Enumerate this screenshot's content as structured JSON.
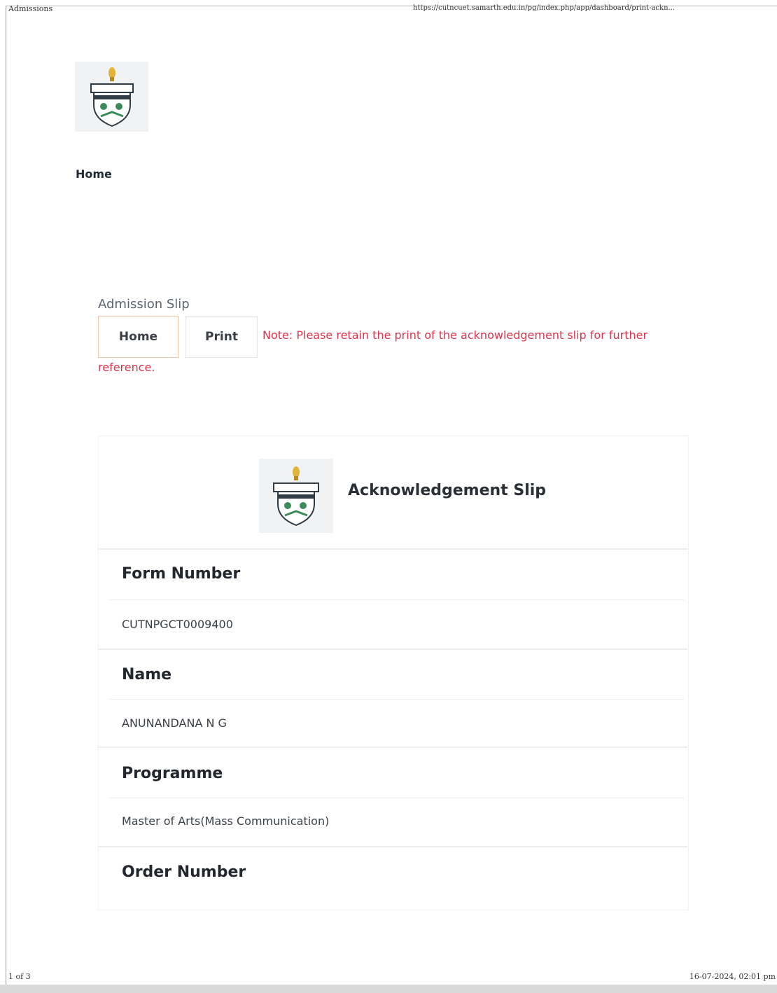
{
  "print_header": {
    "title": "Admissions",
    "url": "https://cutncuet.samarth.edu.in/pg/index.php/app/dashboard/print-ackn..."
  },
  "print_footer": {
    "page": "1 of 3",
    "datetime": "16-07-2024, 02:01 pm"
  },
  "nav": {
    "home_label": "Home"
  },
  "slip_section": {
    "title": "Admission Slip",
    "home_button": "Home",
    "print_button": "Print",
    "note_line1": "Note: Please retain the print of the acknowledgement slip for further",
    "note_line2": "reference."
  },
  "slip": {
    "title": "Acknowledgement Slip",
    "fields": [
      {
        "label": "Form Number",
        "value": "CUTNPGCT0009400"
      },
      {
        "label": "Name",
        "value": "ANUNANDANA N G"
      },
      {
        "label": "Programme",
        "value": "Master of Arts(Mass Communication)"
      },
      {
        "label": "Order Number",
        "value": ""
      }
    ]
  },
  "colors": {
    "note_red": "#e0314a",
    "home_button_border": "#f1c7a8",
    "logo_bg": "#f1f2f3"
  },
  "icons": {
    "university_logo": "university-emblem-icon"
  }
}
